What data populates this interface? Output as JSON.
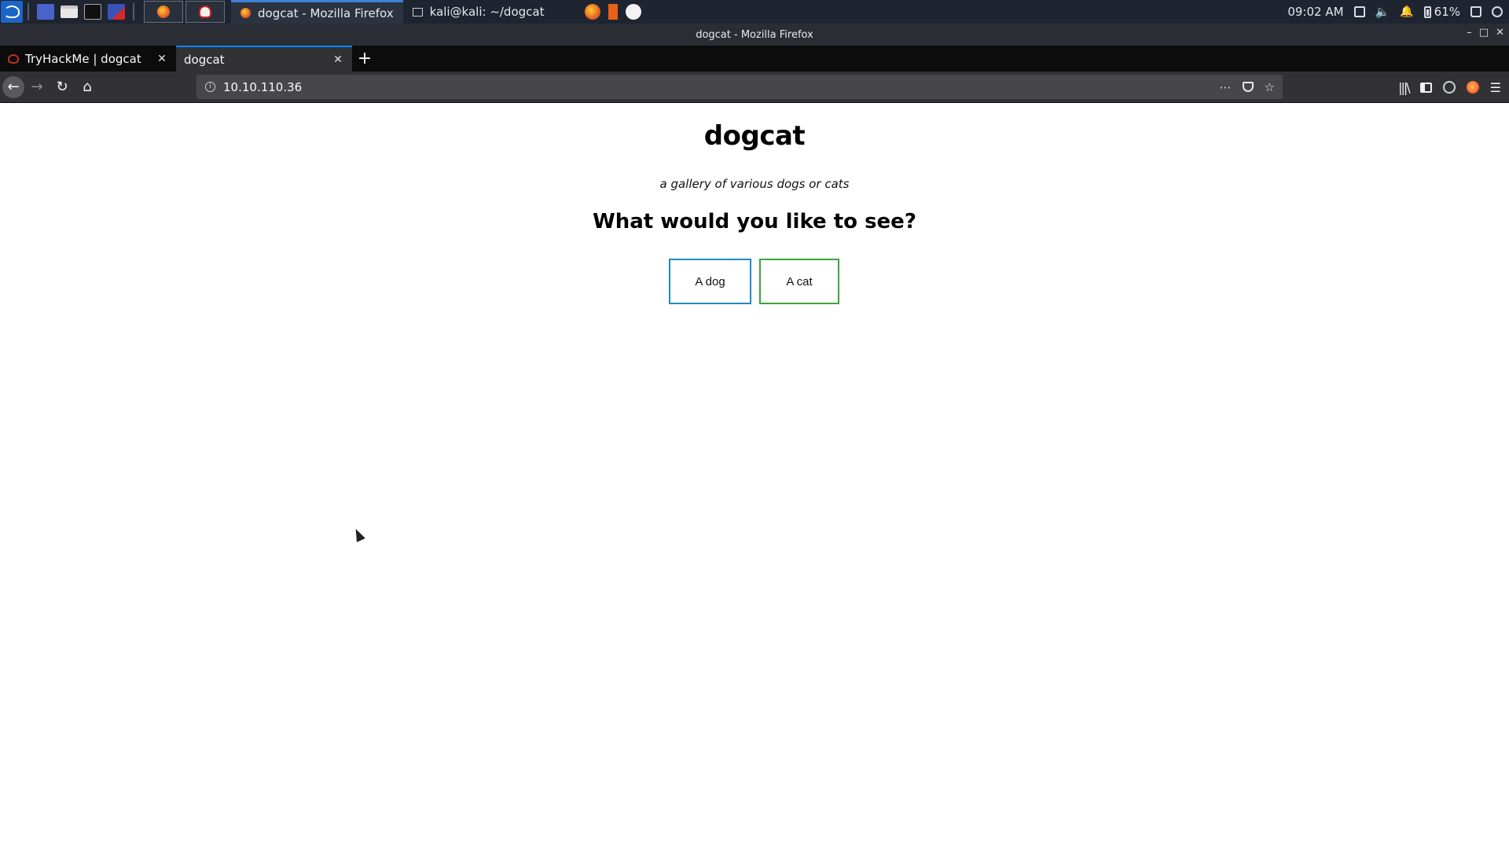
{
  "panel": {
    "tasks": [
      {
        "label": "dogcat - Mozilla Firefox",
        "active": true
      },
      {
        "label": "kali@kali: ~/dogcat",
        "active": false
      }
    ],
    "time": "09:02 AM",
    "battery": "61%"
  },
  "window": {
    "title": "dogcat - Mozilla Firefox"
  },
  "tabs": [
    {
      "label": "TryHackMe | dogcat",
      "active": false
    },
    {
      "label": "dogcat",
      "active": true
    }
  ],
  "url": "10.10.110.36",
  "page": {
    "title": "dogcat",
    "subtitle": "a gallery of various dogs or cats",
    "prompt": "What would you like to see?",
    "buttons": {
      "dog": "A dog",
      "cat": "A cat"
    },
    "colors": {
      "dog_border": "#1d8cc1",
      "cat_border": "#3aa63a"
    }
  }
}
